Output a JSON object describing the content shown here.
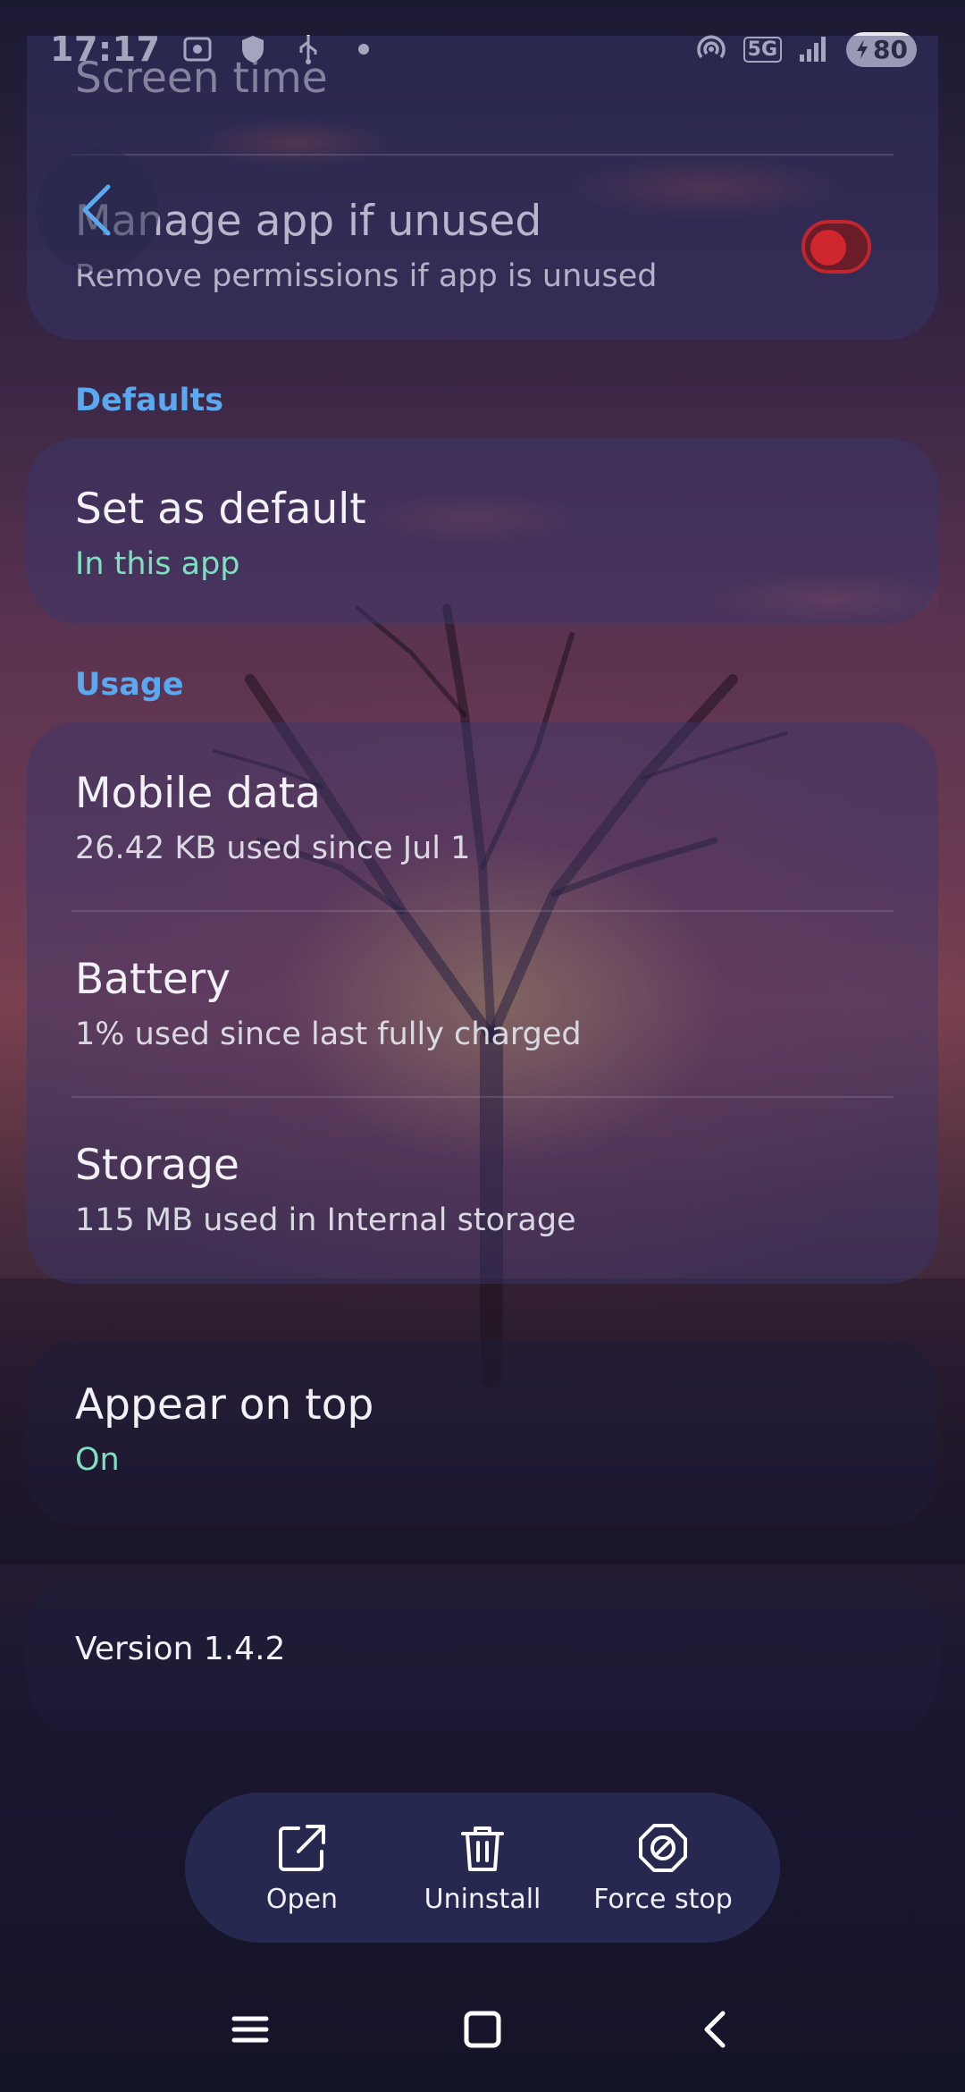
{
  "status_bar": {
    "time": "17:17",
    "network": "5G",
    "battery_level": "80"
  },
  "app_settings": {
    "top_card": {
      "screen_time_label": "Screen time",
      "manage_unused_title": "Manage app if unused",
      "manage_unused_subtitle": "Remove permissions if app is unused",
      "manage_unused_toggle_on": true
    },
    "defaults": {
      "section_label": "Defaults",
      "set_default_title": "Set as default",
      "set_default_subtitle": "In this app"
    },
    "usage": {
      "section_label": "Usage",
      "items": [
        {
          "title": "Mobile data",
          "subtitle": "26.42 KB used since Jul 1"
        },
        {
          "title": "Battery",
          "subtitle": "1% used since last fully charged"
        },
        {
          "title": "Storage",
          "subtitle": "115 MB used in Internal storage"
        }
      ]
    },
    "appear_on_top": {
      "title": "Appear on top",
      "subtitle": "On"
    },
    "version_text": "Version 1.4.2"
  },
  "actions": {
    "open_label": "Open",
    "uninstall_label": "Uninstall",
    "force_stop_label": "Force stop"
  },
  "icons": {
    "back": "chevron-left-icon",
    "open": "open-external-icon",
    "uninstall": "trash-icon",
    "force_stop": "block-icon",
    "nav_recents": "menu-lines-icon",
    "nav_home": "square-icon",
    "nav_back": "chevron-left-icon"
  },
  "colors": {
    "accent_blue": "#5aa8f0",
    "accent_green": "#7fe0c0",
    "toggle_red": "#c0262e"
  }
}
